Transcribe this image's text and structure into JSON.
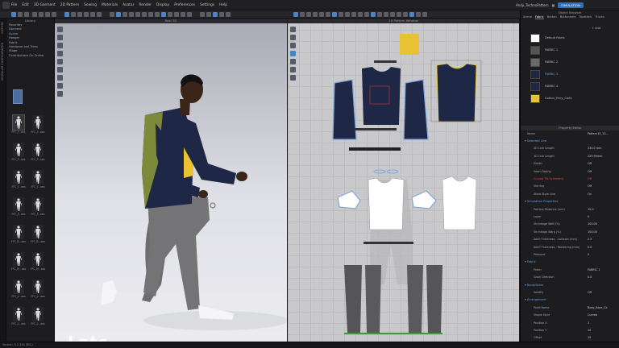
{
  "menubar": {
    "items": [
      "File",
      "Edit",
      "3D Garment",
      "2D Pattern",
      "Sewing",
      "Materials",
      "Avatar",
      "Render",
      "Display",
      "Preferences",
      "Settings",
      "Help"
    ],
    "user": "Andy_TechnoPattern",
    "simulation": "SIMULATION"
  },
  "vertical_tabs": {
    "history": "HISTORY",
    "modular": "MODULAR CONFIGURATOR"
  },
  "library": {
    "title": "Library",
    "nav": [
      "Favorites",
      "Garment",
      "Avatar",
      "Hanger",
      "Fabric",
      "Hardware and Trims",
      "Stage",
      "Contributions On Online"
    ],
    "nav_active_index": 2,
    "thumbs": [
      "FFC_F...aes",
      "FFC_F...aes",
      "FFC_F...aes",
      "FFC_F...aes",
      "FFC_F...aes",
      "FFC_F...aes",
      "FFC_F...aes",
      "FFC_F...aes",
      "FFC_B...aes",
      "FFC_B...aes",
      "FFC_M...aes",
      "FFC_M...aes",
      "FFC_L...aes",
      "FFC_L...aes",
      "FFC_L...aes",
      "FFC_L...aes"
    ]
  },
  "view3d": {
    "title": "Real 3D",
    "watermark": "Latc"
  },
  "view2d": {
    "title": "2D Pattern Window"
  },
  "object_browser": {
    "title": "Object Browser",
    "tabs": [
      "Scene",
      "Fabric",
      "Button",
      "Buttonhole",
      "Topstitch",
      "Trucks"
    ],
    "add_label": "+ Add",
    "fabrics": [
      {
        "name": "Default Fabric",
        "color": "#ffffff"
      },
      {
        "name": "FABRIC 1",
        "color": "#555555"
      },
      {
        "name": "FABRIC 2",
        "color": "#6a6a6a"
      },
      {
        "name": "FABRIC 3",
        "color": "#1f2747"
      },
      {
        "name": "FABRIC 4",
        "color": "#1f2747"
      },
      {
        "name": "Cotton_Terry_Cloth",
        "color": "#e8c232"
      }
    ]
  },
  "property_editor": {
    "title": "Property Editor",
    "name_label": "Name",
    "name_value": "Pattern15_13...",
    "sections": {
      "selected_line": "Selected Line",
      "simulation": "Simulation Properties",
      "fabric": "Fabric",
      "bond": "Bond/Skive",
      "arrangement": "Arrangement"
    },
    "rows": [
      {
        "k": "2D Line Length",
        "v": "230.0 mm"
      },
      {
        "k": "3D Line Length",
        "v": "229.99mm"
      },
      {
        "k": "Elastic",
        "v": "Off"
      },
      {
        "k": "Seam Taping",
        "v": "Off"
      },
      {
        "k": "Curved Tilt Symmetry",
        "v": "Off"
      },
      {
        "k": "Shirring",
        "v": "Off"
      },
      {
        "k": "Show Style Line",
        "v": "On"
      },
      {
        "k": "Particle Distance (mm)",
        "v": "10.0"
      },
      {
        "k": "Layer",
        "v": "0"
      },
      {
        "k": "Shrinkage Weft (%)",
        "v": "100.00"
      },
      {
        "k": "Shrinkage Warp (%)",
        "v": "100.00"
      },
      {
        "k": "Add'l Thickness - Collision (mm)",
        "v": "2.5"
      },
      {
        "k": "Add'l Thickness - Rendering (mm)",
        "v": "0.0"
      },
      {
        "k": "Pressure",
        "v": "0"
      },
      {
        "k": "Fabric",
        "v": "FABRIC 1"
      },
      {
        "k": "Grain Direction",
        "v": "0.0"
      },
      {
        "k": "Solidify",
        "v": "Off"
      },
      {
        "k": "Point Name",
        "v": "Body_Back_Ce"
      },
      {
        "k": "Shape Style",
        "v": "Curved"
      },
      {
        "k": "Position X",
        "v": "1"
      },
      {
        "k": "Position Y",
        "v": "10"
      },
      {
        "k": "Offset",
        "v": "10"
      }
    ]
  },
  "statusbar": {
    "version": "Version: 5.2.334 (REL)"
  },
  "colors": {
    "accent": "#4a83c7",
    "navy": "#1f2747",
    "yellow": "#e8c232",
    "olive": "#7d8a3a",
    "pants": "#6d6d6f"
  }
}
